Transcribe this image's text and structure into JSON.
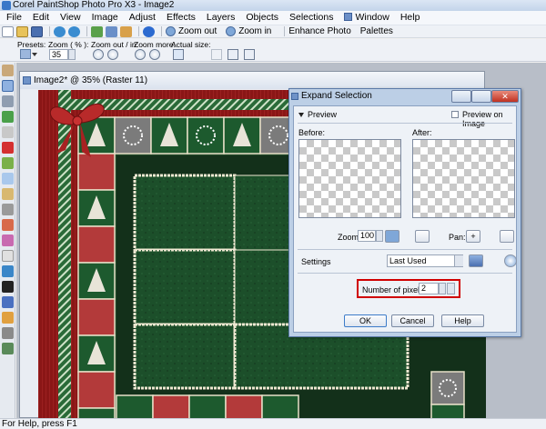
{
  "app": {
    "title": "Corel PaintShop Photo Pro X3 - Image2"
  },
  "menu": [
    "File",
    "Edit",
    "View",
    "Image",
    "Adjust",
    "Effects",
    "Layers",
    "Objects",
    "Selections",
    "Window",
    "Help"
  ],
  "toolbar": {
    "zoom_out_label": "Zoom out",
    "zoom_in_label": "Zoom in",
    "enhance_label": "Enhance Photo",
    "palettes_label": "Palettes"
  },
  "tool_options": {
    "presets_label": "Presets:",
    "zoom_pct_label": "Zoom ( % ):",
    "zoom_value": "35",
    "zoom_out_in_label": "Zoom out / in:",
    "zoom_more_label": "Zoom more:",
    "actual_size_label": "Actual size:"
  },
  "image_window": {
    "title": "Image2* @  35% (Raster 11)"
  },
  "dialog": {
    "title": "Expand Selection",
    "preview_label": "Preview",
    "preview_on_image_label": "Preview on Image",
    "before_label": "Before:",
    "after_label": "After:",
    "zoom_label": "Zoom:",
    "zoom_value": "100",
    "pan_label": "Pan:",
    "settings_label": "Settings",
    "settings_value": "Last Used",
    "pixels_label": "Number of pixels:",
    "pixels_value": "2",
    "ok_label": "OK",
    "cancel_label": "Cancel",
    "help_label": "Help"
  },
  "status": {
    "text": "For Help, press F1"
  },
  "colors": {
    "title_bar": "#c3d4ea",
    "frame_red": "#8a1616",
    "tile_green": "#1d5a2e",
    "tile_red": "#b33a3a",
    "tile_gray": "#7b7b7b",
    "highlight_red": "#d00000",
    "dialog_blue": "#bccfe6"
  }
}
